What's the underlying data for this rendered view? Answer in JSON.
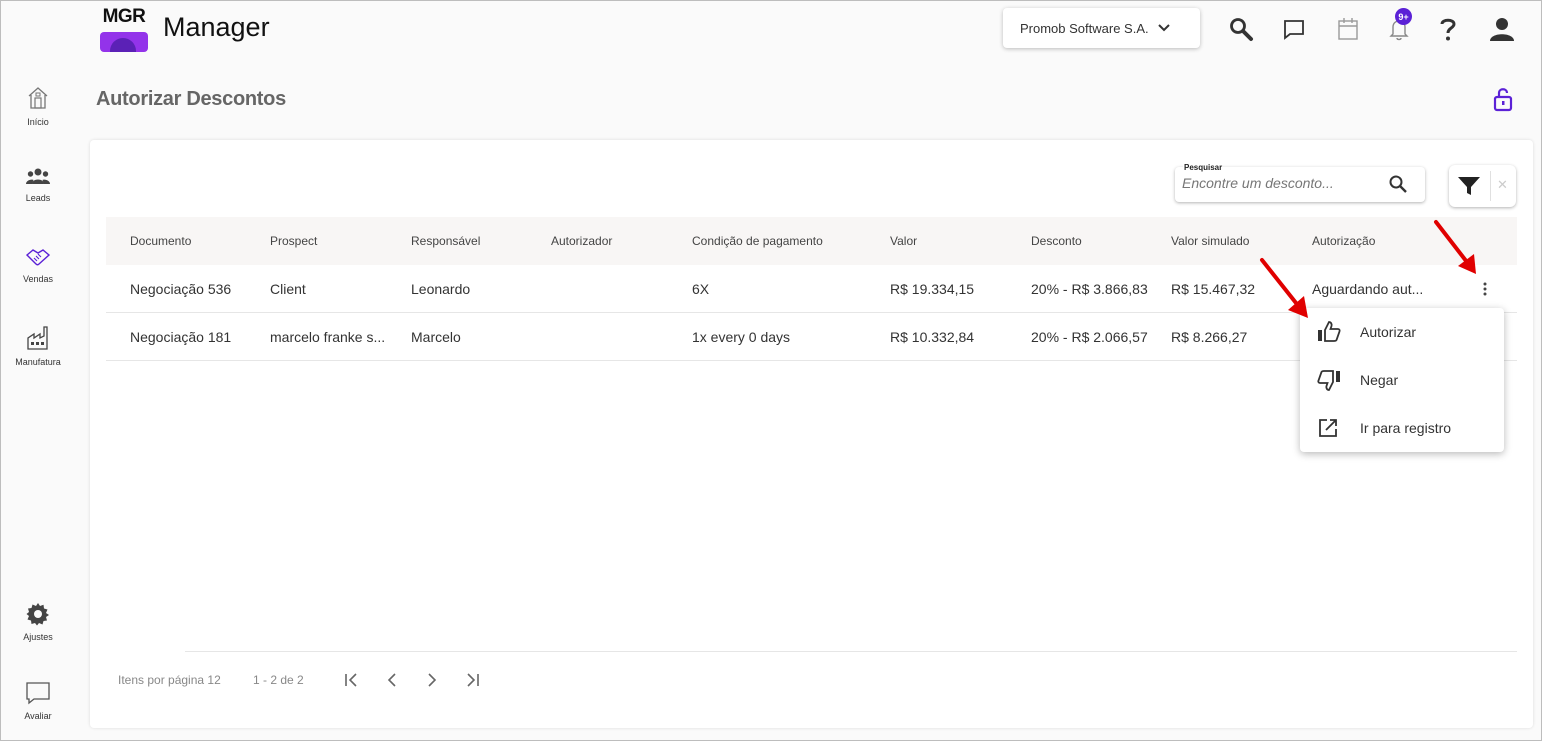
{
  "app": {
    "logo_text": "MGR",
    "title": "Manager",
    "company": "Promob Software S.A.",
    "notification_badge": "9+",
    "brand_color": "#5b21d6"
  },
  "sidebar": {
    "items": [
      {
        "label": "Início",
        "icon": "home-icon"
      },
      {
        "label": "Leads",
        "icon": "people-icon"
      },
      {
        "label": "Vendas",
        "icon": "handshake-icon"
      },
      {
        "label": "Manufatura",
        "icon": "factory-icon"
      },
      {
        "label": "Ajustes",
        "icon": "gear-icon"
      },
      {
        "label": "Avaliar",
        "icon": "comment-icon"
      }
    ]
  },
  "page": {
    "title": "Autorizar Descontos"
  },
  "search": {
    "label": "Pesquisar",
    "placeholder": "Encontre um desconto..."
  },
  "filter": {
    "clear_glyph": "✕"
  },
  "table": {
    "columns": [
      "Documento",
      "Prospect",
      "Responsável",
      "Autorizador",
      "Condição de pagamento",
      "Valor",
      "Desconto",
      "Valor simulado",
      "Autorização"
    ],
    "rows": [
      {
        "documento": "Negociação 536",
        "prospect": "Client",
        "responsavel": "Leonardo",
        "autorizador": "",
        "condicao": "6X",
        "valor": "R$ 19.334,15",
        "desconto": "20% - R$ 3.866,83",
        "valor_simulado": "R$ 15.467,32",
        "autorizacao": "Aguardando aut..."
      },
      {
        "documento": "Negociação 181",
        "prospect": "marcelo franke s...",
        "responsavel": "Marcelo",
        "autorizador": "",
        "condicao": "1x every 0 days",
        "valor": "R$ 10.332,84",
        "desconto": "20% - R$ 2.066,57",
        "valor_simulado": "R$ 8.266,27",
        "autorizacao": ""
      }
    ]
  },
  "context_menu": {
    "items": [
      {
        "label": "Autorizar",
        "icon": "thumbs-up-icon"
      },
      {
        "label": "Negar",
        "icon": "thumbs-down-icon"
      },
      {
        "label": "Ir para registro",
        "icon": "open-external-icon"
      }
    ]
  },
  "pagination": {
    "items_per_page": "Itens por página 12",
    "range": "1 - 2 de 2"
  },
  "annotation_color": "#e00000"
}
